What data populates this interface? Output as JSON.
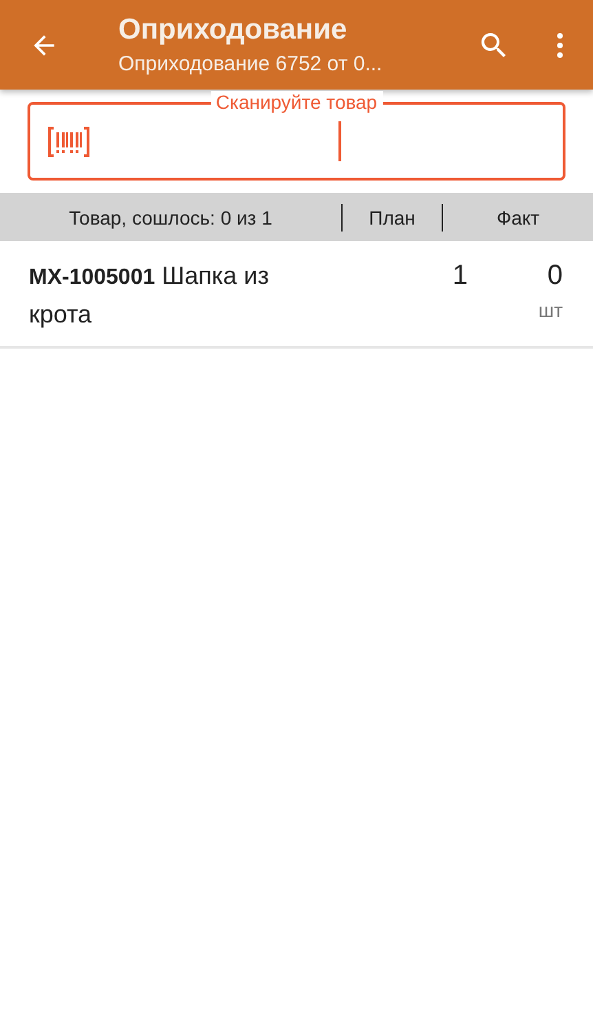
{
  "app_bar": {
    "title": "Оприходование",
    "subtitle": "Оприходование 6752 от 0..."
  },
  "scan_field": {
    "label": "Сканируйте товар"
  },
  "table": {
    "columns": [
      "Товар, сошлось: 0 из 1",
      "План",
      "Факт"
    ],
    "rows": [
      {
        "product": "**MX-1005001** Шапка из крота",
        "plan": "1",
        "fact": "0",
        "unit": "шт"
      }
    ]
  }
}
